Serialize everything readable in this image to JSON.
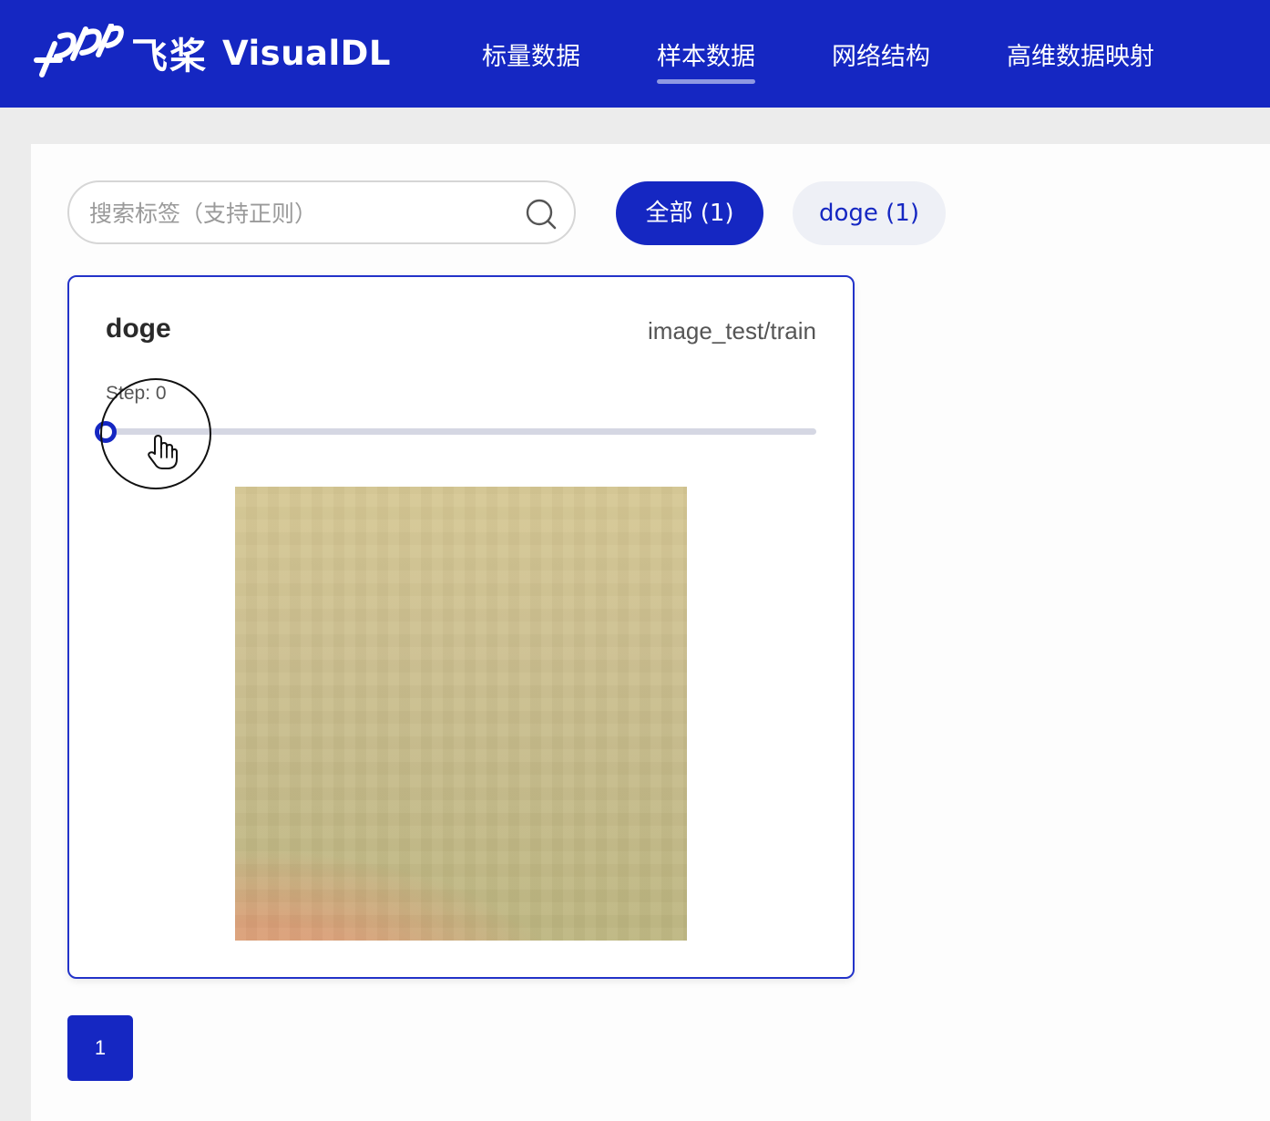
{
  "header": {
    "brand_cn": "飞桨",
    "brand_en": "VisualDL",
    "nav": [
      {
        "label": "标量数据",
        "active": false
      },
      {
        "label": "样本数据",
        "active": true
      },
      {
        "label": "网络结构",
        "active": false
      },
      {
        "label": "高维数据映射",
        "active": false
      }
    ]
  },
  "search": {
    "placeholder": "搜索标签（支持正则）",
    "value": ""
  },
  "tags": [
    {
      "label": "全部 (1)",
      "selected": true
    },
    {
      "label": "doge (1)",
      "selected": false
    }
  ],
  "card": {
    "title": "doge",
    "run": "image_test/train",
    "step_label": "Step: 0",
    "step": 0
  },
  "pagination": {
    "current": "1"
  },
  "colors": {
    "brand": "#1527c2",
    "tag_inactive_bg": "#eef0f6",
    "track": "#d5d7e3"
  }
}
